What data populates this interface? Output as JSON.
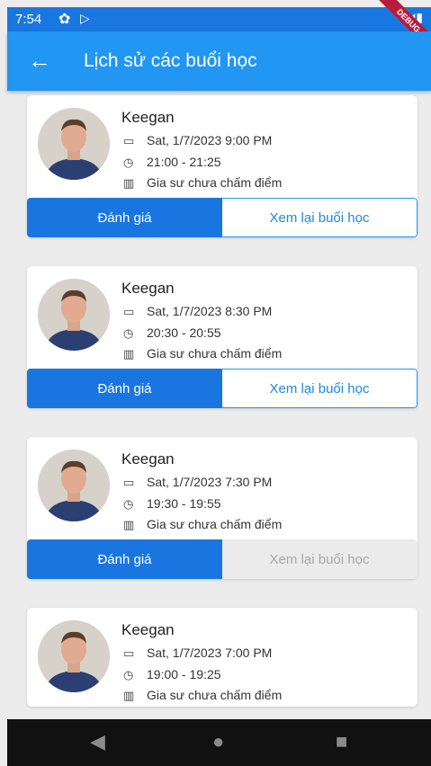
{
  "status_bar": {
    "time": "7:54",
    "debug": "DEBUG"
  },
  "app_bar": {
    "title": "Lịch sử các buổi học"
  },
  "sessions": [
    {
      "name": "Keegan",
      "date": "Sat, 1/7/2023 9:00 PM",
      "time_range": "21:00 - 21:25",
      "review": "Gia sư chưa chấm điểm",
      "rate_label": "Đánh giá",
      "replay_label": "Xem lại buổi học",
      "replay_enabled": true
    },
    {
      "name": "Keegan",
      "date": "Sat, 1/7/2023 8:30 PM",
      "time_range": "20:30 - 20:55",
      "review": "Gia sư chưa chấm điểm",
      "rate_label": "Đánh giá",
      "replay_label": "Xem lại buổi học",
      "replay_enabled": true
    },
    {
      "name": "Keegan",
      "date": "Sat, 1/7/2023 7:30 PM",
      "time_range": "19:30 - 19:55",
      "review": "Gia sư chưa chấm điểm",
      "rate_label": "Đánh giá",
      "replay_label": "Xem lại buổi học",
      "replay_enabled": false
    },
    {
      "name": "Keegan",
      "date": "Sat, 1/7/2023 7:00 PM",
      "time_range": "19:00 - 19:25",
      "review": "Gia sư chưa chấm điểm"
    }
  ],
  "icons": {
    "date": "calendar-icon",
    "time": "clock-icon",
    "review": "review-status-icon"
  },
  "colors": {
    "app_bar": "#2196f3",
    "status_bar": "#1977e1",
    "primary_button": "#1976e0",
    "disabled_button": "#ebebeb"
  }
}
